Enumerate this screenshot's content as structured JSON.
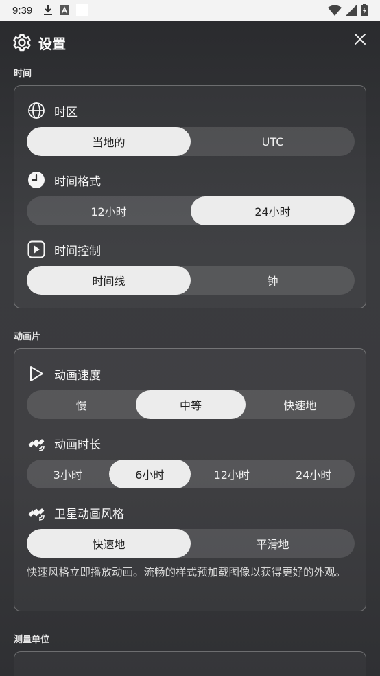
{
  "status_bar": {
    "time": "9:39"
  },
  "header": {
    "title": "设置"
  },
  "sections": {
    "time": {
      "label": "时间",
      "timezone": {
        "title": "时区",
        "options": [
          "当地的",
          "UTC"
        ],
        "selected": 0
      },
      "time_format": {
        "title": "时间格式",
        "options": [
          "12小时",
          "24小时"
        ],
        "selected": 1
      },
      "time_control": {
        "title": "时间控制",
        "options": [
          "时间线",
          "钟"
        ],
        "selected": 0
      }
    },
    "animation": {
      "label": "动画片",
      "speed": {
        "title": "动画速度",
        "options": [
          "慢",
          "中等",
          "快速地"
        ],
        "selected": 1
      },
      "duration": {
        "title": "动画时长",
        "options": [
          "3小时",
          "6小时",
          "12小时",
          "24小时"
        ],
        "selected": 1
      },
      "style": {
        "title": "卫星动画风格",
        "options": [
          "快速地",
          "平滑地"
        ],
        "selected": 0
      },
      "description": "快速风格立即播放动画。流畅的样式预加载图像以获得更好的外观。"
    },
    "units": {
      "label": "测量单位"
    }
  }
}
